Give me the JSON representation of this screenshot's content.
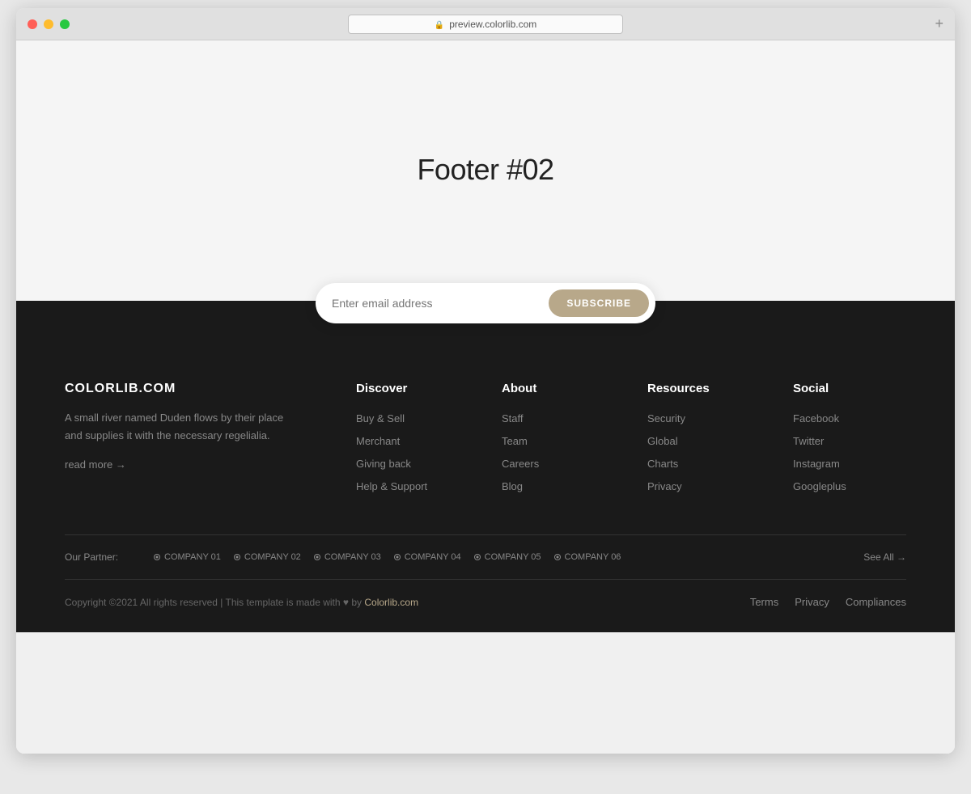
{
  "browser": {
    "url": "preview.colorlib.com",
    "new_tab_icon": "+"
  },
  "hero": {
    "title": "Footer #02"
  },
  "subscribe": {
    "input_placeholder": "Enter email address",
    "button_label": "SUBSCRIBE"
  },
  "footer": {
    "brand": {
      "name": "COLORLIB.COM",
      "description": "A small river named Duden flows by their place and supplies it with the necessary regelialia.",
      "read_more": "read more →"
    },
    "columns": [
      {
        "title": "Discover",
        "links": [
          "Buy & Sell",
          "Merchant",
          "Giving back",
          "Help & Support"
        ]
      },
      {
        "title": "About",
        "links": [
          "Staff",
          "Team",
          "Careers",
          "Blog"
        ]
      },
      {
        "title": "Resources",
        "links": [
          "Security",
          "Global",
          "Charts",
          "Privacy"
        ]
      },
      {
        "title": "Social",
        "links": [
          "Facebook",
          "Twitter",
          "Instagram",
          "Googleplus"
        ]
      }
    ],
    "partners": {
      "label": "Our Partner:",
      "companies": [
        "COMPANY 01",
        "COMPANY 02",
        "COMPANY 03",
        "COMPANY 04",
        "COMPANY 05",
        "COMPANY 06"
      ],
      "see_all": "See All →"
    },
    "bottom": {
      "copyright": "Copyright ©2021 All rights reserved | This template is made with ♥ by",
      "copyright_link_text": "Colorlib.com",
      "legal_links": [
        "Terms",
        "Privacy",
        "Compliances"
      ]
    }
  }
}
